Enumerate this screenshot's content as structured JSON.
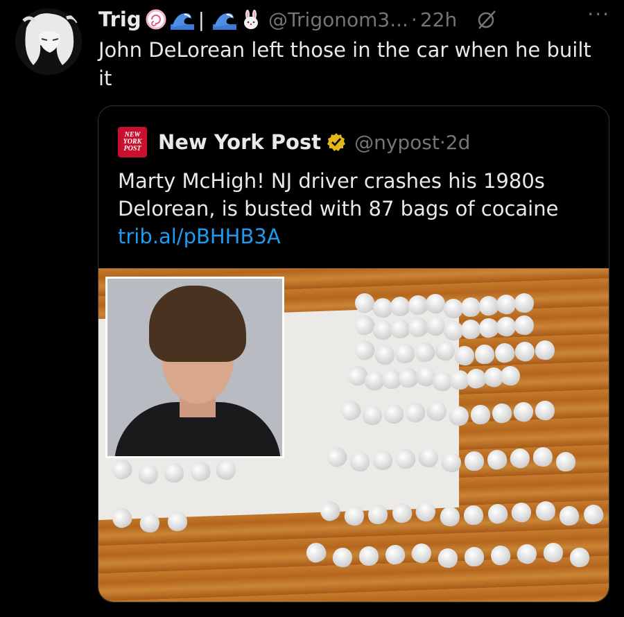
{
  "tweet": {
    "display_name": "Trig",
    "handle": "@Trigonom3...",
    "separator": "·",
    "time": "22h",
    "pipe": "|",
    "more_label": "···",
    "text": "John DeLorean left those in the car when he built it",
    "icons": [
      "avatar",
      "fishcake-emoji",
      "wave-emoji",
      "wave-emoji",
      "rabbit-emoji",
      "grok-icon",
      "more-icon"
    ]
  },
  "quote": {
    "display_name": "New York Post",
    "handle": "@nypost",
    "separator": "·",
    "time": "2d",
    "logo_lines": [
      "NEW",
      "YORK",
      "POST"
    ],
    "text": "Marty McHigh! NJ driver crashes his 1980s Delorean, is busted with 87 bags of cocaine",
    "link": "trib.al/pBHHB3A",
    "colors": {
      "logo": "#c8102e",
      "badge": "#e2b719",
      "link": "#1d9bf0"
    }
  },
  "colors": {
    "background": "#000000",
    "text": "#e7e9ea",
    "muted": "#71767b",
    "border": "#2f3336"
  }
}
